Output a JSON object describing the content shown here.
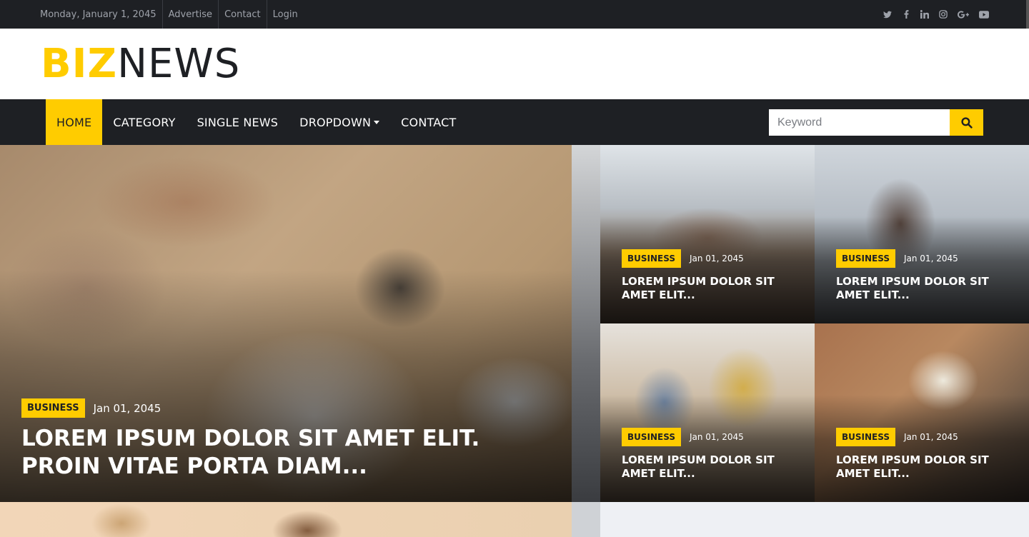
{
  "topbar": {
    "date": "Monday, January 1, 2045",
    "links": [
      "Advertise",
      "Contact",
      "Login"
    ],
    "social_icons": [
      "twitter-icon",
      "facebook-icon",
      "linkedin-icon",
      "instagram-icon",
      "google-plus-icon",
      "youtube-icon"
    ]
  },
  "logo": {
    "biz": "BIZ",
    "news": "NEWS"
  },
  "nav": {
    "items": [
      "HOME",
      "CATEGORY",
      "SINGLE NEWS",
      "DROPDOWN",
      "CONTACT"
    ],
    "active": "HOME"
  },
  "search": {
    "placeholder": "Keyword",
    "button_icon": "search-icon"
  },
  "hero": {
    "badge": "BUSINESS",
    "date": "Jan 01, 2045",
    "title": "LOREM IPSUM DOLOR SIT AMET ELIT. PROIN VITAE PORTA DIAM..."
  },
  "cards": [
    {
      "badge": "BUSINESS",
      "date": "Jan 01, 2045",
      "title": "LOREM IPSUM DOLOR SIT AMET ELIT..."
    },
    {
      "badge": "BUSINESS",
      "date": "Jan 01, 2045",
      "title": "LOREM IPSUM DOLOR SIT AMET ELIT..."
    },
    {
      "badge": "BUSINESS",
      "date": "Jan 01, 2045",
      "title": "LOREM IPSUM DOLOR SIT AMET ELIT..."
    },
    {
      "badge": "BUSINESS",
      "date": "Jan 01, 2045",
      "title": "LOREM IPSUM DOLOR SIT AMET ELIT..."
    }
  ],
  "colors": {
    "accent": "#ffcc00",
    "dark": "#1e2024",
    "muted": "#9ea2aa"
  }
}
